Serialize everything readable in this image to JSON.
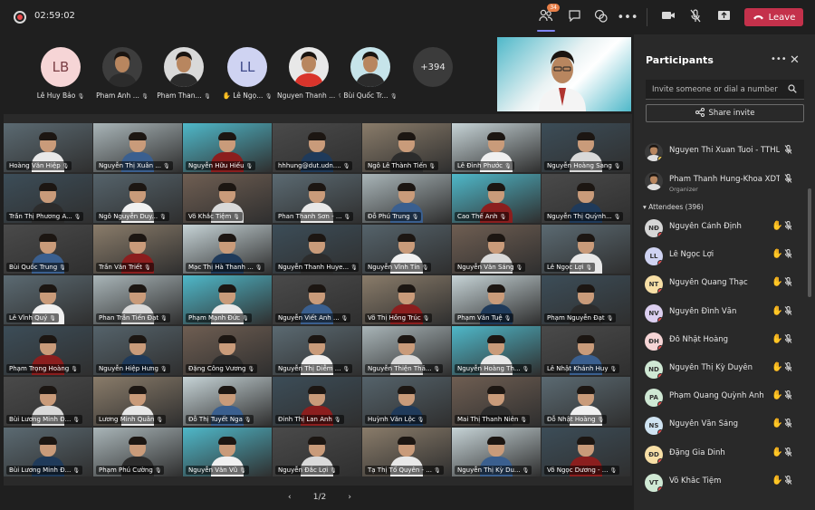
{
  "topbar": {
    "timer": "02:59:02",
    "participants_badge": "34",
    "leave_label": "Leave",
    "icons": [
      "record-icon",
      "participants-icon",
      "chat-icon",
      "reactions-icon",
      "more-icon",
      "camera-icon",
      "mic-off-icon",
      "share-icon",
      "phone-icon"
    ]
  },
  "strip": [
    {
      "initials": "LB",
      "name": "Lê Huy Bảo",
      "color": "#f6d5d6",
      "text": "#7a3e44"
    },
    {
      "initials": "",
      "name": "Pham Anh ...",
      "color": "#3d3d3d"
    },
    {
      "initials": "",
      "name": "Pham Than...",
      "color": "#d9d9d9"
    },
    {
      "initials": "LL",
      "name": "Lê Ngọ...",
      "color": "#cfd3f2",
      "text": "#3f4a8a",
      "hand": true
    },
    {
      "initials": "",
      "name": "Nguyen Thanh ...",
      "color": "#e8e8e8"
    },
    {
      "initials": "",
      "name": "Bùi Quốc Tr...",
      "color": "#c6e4ea"
    },
    {
      "initials": "+394",
      "name": "",
      "color": "#3b3b3b"
    }
  ],
  "grid": [
    [
      "Hoàng Văn Hiệp",
      "Nguyễn Thị Xuân ...",
      "Nguyễn Hữu Hiếu",
      "hhhung@dut.udn....",
      "Ngô Lê Thành Tiến",
      "Lê Đình Phước",
      "Nguyễn Hoàng Sang"
    ],
    [
      "Trần Thị Phương A...",
      "Ngô Nguyễn Duy...",
      "Võ Khắc Tiệm",
      "Phan Thanh Sơn - ...",
      "Đỗ Phú Trung",
      "Cao Thế Anh",
      "Nguyễn Thị Quỳnh..."
    ],
    [
      "Bùi Quốc Trung",
      "Trần Văn Triết",
      "Mạc Thị Hà Thanh ...",
      "Nguyễn Thanh Huye...",
      "Nguyễn Vĩnh Tín",
      "Nguyễn Văn Sáng",
      "Lê Ngọc Lợi"
    ],
    [
      "Lê Vĩnh Quý",
      "Phan Trần Tiến Đạt",
      "Phạm Mạnh Đức",
      "Nguyễn Viết Anh ...",
      "Võ Thị Hồng Trúc",
      "Phạm Văn Tuệ",
      "Phạm Nguyễn Đạt"
    ],
    [
      "Phạm Trọng Hoàng",
      "Nguyễn Hiệp Hưng",
      "Đặng Công Vương",
      "Nguyễn Thị Diễm ...",
      "Nguyễn Thiện Thả...",
      "Nguyễn Hoàng Th...",
      "Lê Nhật Khánh Huy"
    ],
    [
      "Bùi Lương Minh Đ...",
      "Lương Minh Quân",
      "Đỗ Thị Tuyết Nga",
      "Đinh Thị Lan Anh",
      "Huỳnh Văn Lộc",
      "Mai Thị Thanh Niên",
      "Đỗ Nhật Hoàng"
    ],
    [
      "Bùi Lương Minh Đ...",
      "Phạm Phú Cường",
      "Nguyễn Văn Vũ",
      "Nguyễn Đắc Lợi",
      "Tạ Thị Tố Quyên - ...",
      "Nguyễn Thị Kỳ Du...",
      "Võ Ngọc Dương - ..."
    ]
  ],
  "pager": {
    "label": "1/2"
  },
  "panel": {
    "title": "Participants",
    "invite_placeholder": "Invite someone or dial a number",
    "share_label": "Share invite",
    "attendees_label": "Attendees (396)",
    "organizers": [
      {
        "name": "Nguyen Thi Xuan Tuoi - TTHL",
        "role": ""
      },
      {
        "name": "Pham Thanh Hung-Khoa XDT...",
        "role": "Organizer"
      }
    ],
    "attendees": [
      {
        "initials": "NĐ",
        "name": "Nguyễn Cảnh Định",
        "color": "#d6d6d6"
      },
      {
        "initials": "LL",
        "name": "Lê Ngọc Lợi",
        "color": "#cfd3f2"
      },
      {
        "initials": "NT",
        "name": "Nguyễn Quang Thạc",
        "color": "#f7dfa6"
      },
      {
        "initials": "NV",
        "name": "Nguyễn Đình Văn",
        "color": "#dccff0"
      },
      {
        "initials": "ĐH",
        "name": "Đỗ Nhật Hoàng",
        "color": "#f6d5d6"
      },
      {
        "initials": "ND",
        "name": "Nguyễn Thị Kỳ Duyên",
        "color": "#cfe8d4"
      },
      {
        "initials": "PA",
        "name": "Phạm Quang Quỳnh Anh",
        "color": "#cfe8d4"
      },
      {
        "initials": "NS",
        "name": "Nguyễn Văn Sáng",
        "color": "#cfe3f2"
      },
      {
        "initials": "ĐD",
        "name": "Đặng Gia Dinh",
        "color": "#f7dfa6"
      },
      {
        "initials": "VT",
        "name": "Võ Khắc Tiệm",
        "color": "#cfe8d4"
      }
    ]
  }
}
